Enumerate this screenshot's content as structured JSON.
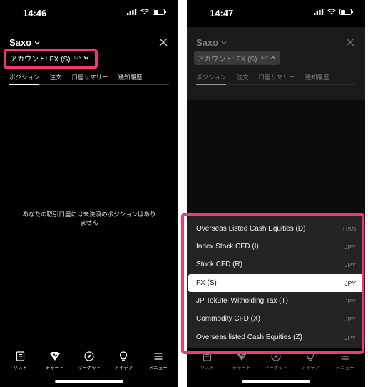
{
  "colors": {
    "highlight": "#ef3a6b",
    "background": "#000000",
    "sheet": "#232325"
  },
  "left": {
    "status_time": "14:46",
    "brand": "Saxo",
    "account_label": "アカウント: FX (S)",
    "account_currency": "JPY",
    "tabs": [
      "ポジション",
      "注文",
      "口座サマリー",
      "通知履歴"
    ],
    "empty_message": "あなたの取引口座には未決済のポジションはありません",
    "nav": [
      "リスト",
      "チャート",
      "マーケット",
      "アイデア",
      "メニュー"
    ]
  },
  "right": {
    "status_time": "14:47",
    "brand": "Saxo",
    "account_label": "アカウント: FX (S)",
    "account_currency": "JPY",
    "tabs": [
      "ポジション",
      "注文",
      "口座サマリー",
      "通知履歴"
    ],
    "nav": [
      "リスト",
      "チャート",
      "マーケット",
      "アイデア",
      "メニュー"
    ],
    "selected_index": 3,
    "accounts": [
      {
        "name": "Overseas Listed Cash Equities (D)",
        "currency": "USD"
      },
      {
        "name": "Index Stock CFD (I)",
        "currency": "JPY"
      },
      {
        "name": "Stock CFD (R)",
        "currency": "JPY"
      },
      {
        "name": "FX (S)",
        "currency": "JPY"
      },
      {
        "name": "JP Tokutei Witholding Tax (T)",
        "currency": "JPY"
      },
      {
        "name": "Commodity CFD (X)",
        "currency": "JPY"
      },
      {
        "name": "Overseas listed Cash Equities (Z)",
        "currency": "JPY"
      }
    ]
  }
}
